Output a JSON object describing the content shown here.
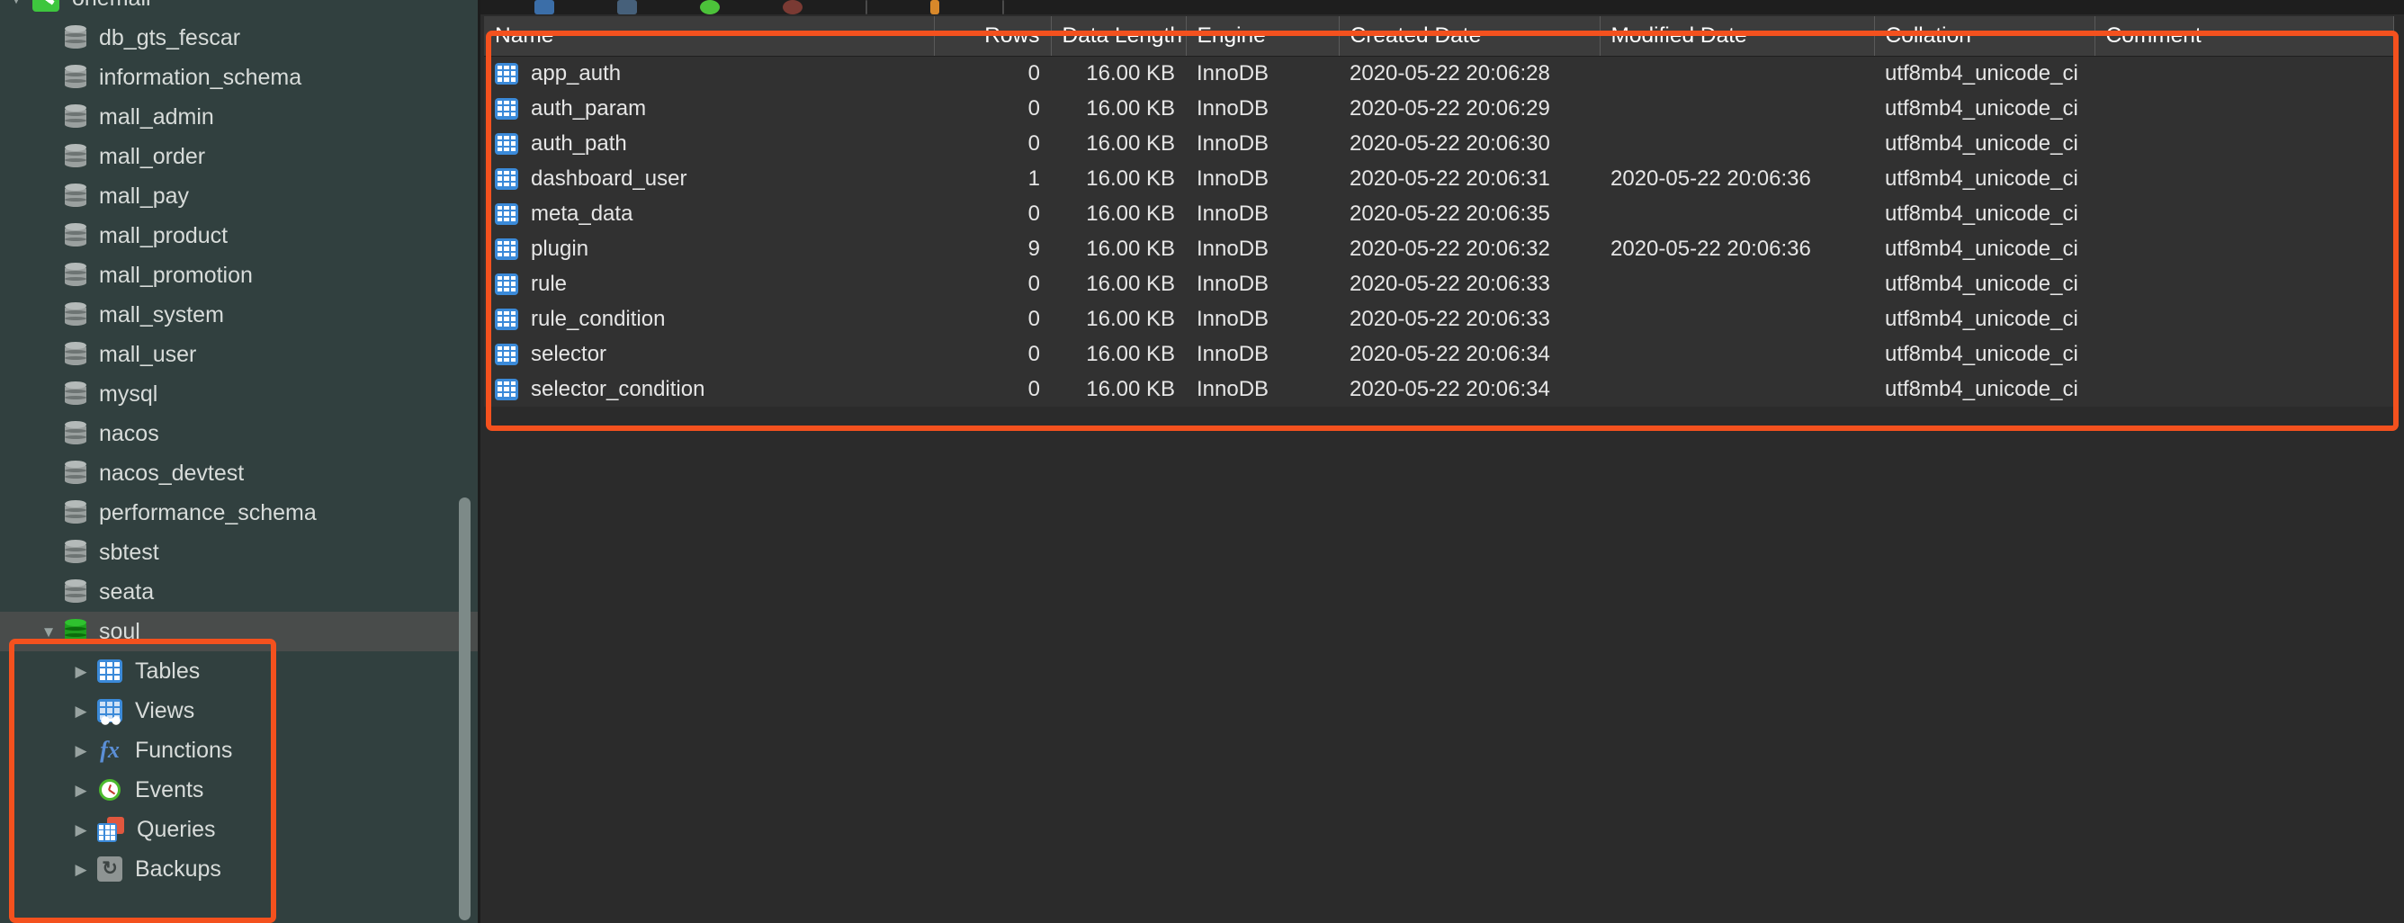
{
  "app": {
    "sidebar_bg": "#31403f",
    "main_bg": "#2b2b2b",
    "annotation_color": "#f4511e"
  },
  "sidebar": {
    "connection": {
      "label": "onemall",
      "icon": "connection-icon",
      "expanded": true
    },
    "databases": [
      {
        "label": "db_gts_fescar",
        "icon": "database-icon"
      },
      {
        "label": "information_schema",
        "icon": "database-icon"
      },
      {
        "label": "mall_admin",
        "icon": "database-icon"
      },
      {
        "label": "mall_order",
        "icon": "database-icon"
      },
      {
        "label": "mall_pay",
        "icon": "database-icon"
      },
      {
        "label": "mall_product",
        "icon": "database-icon"
      },
      {
        "label": "mall_promotion",
        "icon": "database-icon"
      },
      {
        "label": "mall_system",
        "icon": "database-icon"
      },
      {
        "label": "mall_user",
        "icon": "database-icon"
      },
      {
        "label": "mysql",
        "icon": "database-icon"
      },
      {
        "label": "nacos",
        "icon": "database-icon"
      },
      {
        "label": "nacos_devtest",
        "icon": "database-icon"
      },
      {
        "label": "performance_schema",
        "icon": "database-icon"
      },
      {
        "label": "sbtest",
        "icon": "database-icon"
      },
      {
        "label": "seata",
        "icon": "database-icon"
      }
    ],
    "selected_database": {
      "label": "soul",
      "icon": "database-open-icon",
      "expanded": true,
      "selected": true
    },
    "selected_database_children": [
      {
        "label": "Tables",
        "icon": "tables-icon"
      },
      {
        "label": "Views",
        "icon": "views-icon"
      },
      {
        "label": "Functions",
        "icon": "functions-fx-icon"
      },
      {
        "label": "Events",
        "icon": "events-clock-icon"
      },
      {
        "label": "Queries",
        "icon": "queries-icon"
      },
      {
        "label": "Backups",
        "icon": "backups-icon"
      }
    ]
  },
  "toolbar": {
    "icons": [
      "table-icon",
      "view-icon",
      "function-icon",
      "event-icon",
      "divider",
      "query-icon",
      "divider"
    ]
  },
  "grid": {
    "columns": [
      {
        "key": "name",
        "label": "Name",
        "align": "left"
      },
      {
        "key": "rows",
        "label": "Rows",
        "align": "right"
      },
      {
        "key": "data_length",
        "label": "Data Length",
        "align": "right"
      },
      {
        "key": "engine",
        "label": "Engine",
        "align": "left"
      },
      {
        "key": "created",
        "label": "Created Date",
        "align": "left"
      },
      {
        "key": "modified",
        "label": "Modified Date",
        "align": "left"
      },
      {
        "key": "collation",
        "label": "Collation",
        "align": "left"
      },
      {
        "key": "comment",
        "label": "Comment",
        "align": "left"
      }
    ],
    "rows": [
      {
        "icon": "table-icon",
        "name": "app_auth",
        "rows": "0",
        "data_length": "16.00 KB",
        "engine": "InnoDB",
        "created": "2020-05-22 20:06:28",
        "modified": "",
        "collation": "utf8mb4_unicode_ci",
        "comment": ""
      },
      {
        "icon": "table-icon",
        "name": "auth_param",
        "rows": "0",
        "data_length": "16.00 KB",
        "engine": "InnoDB",
        "created": "2020-05-22 20:06:29",
        "modified": "",
        "collation": "utf8mb4_unicode_ci",
        "comment": ""
      },
      {
        "icon": "table-icon",
        "name": "auth_path",
        "rows": "0",
        "data_length": "16.00 KB",
        "engine": "InnoDB",
        "created": "2020-05-22 20:06:30",
        "modified": "",
        "collation": "utf8mb4_unicode_ci",
        "comment": ""
      },
      {
        "icon": "table-icon",
        "name": "dashboard_user",
        "rows": "1",
        "data_length": "16.00 KB",
        "engine": "InnoDB",
        "created": "2020-05-22 20:06:31",
        "modified": "2020-05-22 20:06:36",
        "collation": "utf8mb4_unicode_ci",
        "comment": ""
      },
      {
        "icon": "table-icon",
        "name": "meta_data",
        "rows": "0",
        "data_length": "16.00 KB",
        "engine": "InnoDB",
        "created": "2020-05-22 20:06:35",
        "modified": "",
        "collation": "utf8mb4_unicode_ci",
        "comment": ""
      },
      {
        "icon": "table-icon",
        "name": "plugin",
        "rows": "9",
        "data_length": "16.00 KB",
        "engine": "InnoDB",
        "created": "2020-05-22 20:06:32",
        "modified": "2020-05-22 20:06:36",
        "collation": "utf8mb4_unicode_ci",
        "comment": ""
      },
      {
        "icon": "table-icon",
        "name": "rule",
        "rows": "0",
        "data_length": "16.00 KB",
        "engine": "InnoDB",
        "created": "2020-05-22 20:06:33",
        "modified": "",
        "collation": "utf8mb4_unicode_ci",
        "comment": ""
      },
      {
        "icon": "table-icon",
        "name": "rule_condition",
        "rows": "0",
        "data_length": "16.00 KB",
        "engine": "InnoDB",
        "created": "2020-05-22 20:06:33",
        "modified": "",
        "collation": "utf8mb4_unicode_ci",
        "comment": ""
      },
      {
        "icon": "table-icon",
        "name": "selector",
        "rows": "0",
        "data_length": "16.00 KB",
        "engine": "InnoDB",
        "created": "2020-05-22 20:06:34",
        "modified": "",
        "collation": "utf8mb4_unicode_ci",
        "comment": ""
      },
      {
        "icon": "table-icon",
        "name": "selector_condition",
        "rows": "0",
        "data_length": "16.00 KB",
        "engine": "InnoDB",
        "created": "2020-05-22 20:06:34",
        "modified": "",
        "collation": "utf8mb4_unicode_ci",
        "comment": ""
      }
    ]
  }
}
